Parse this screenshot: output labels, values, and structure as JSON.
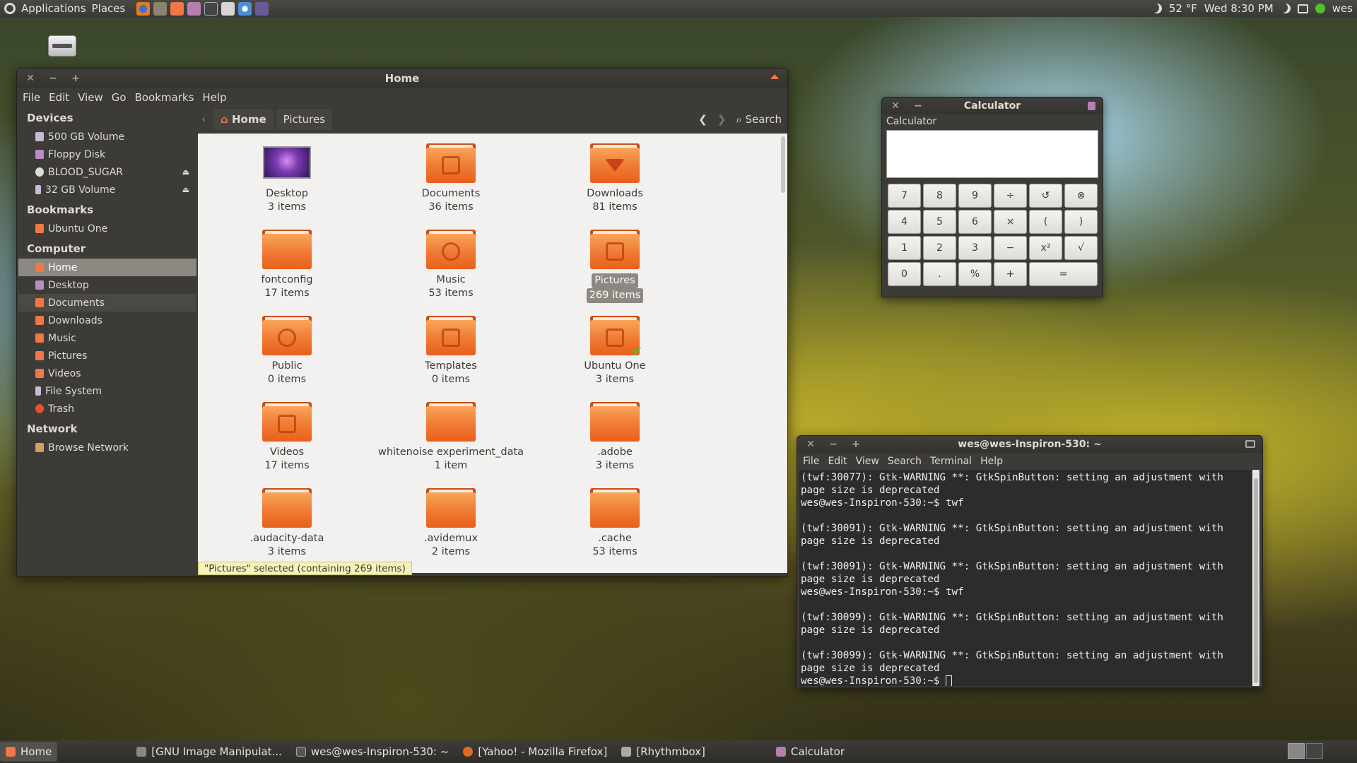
{
  "top_panel": {
    "applications": "Applications",
    "places": "Places",
    "weather": "52 °F",
    "clock": "Wed  8:30 PM",
    "user": "wes"
  },
  "nautilus": {
    "title": "Home",
    "menu": [
      "File",
      "Edit",
      "View",
      "Go",
      "Bookmarks",
      "Help"
    ],
    "sidebar": {
      "devices_header": "Devices",
      "devices": [
        "500 GB Volume",
        "Floppy Disk",
        "BLOOD_SUGAR",
        "32 GB Volume"
      ],
      "bookmarks_header": "Bookmarks",
      "bookmarks": [
        "Ubuntu One"
      ],
      "computer_header": "Computer",
      "computer": [
        "Home",
        "Desktop",
        "Documents",
        "Downloads",
        "Music",
        "Pictures",
        "Videos",
        "File System",
        "Trash"
      ],
      "network_header": "Network",
      "network": [
        "Browse Network"
      ]
    },
    "breadcrumbs": [
      "Home",
      "Pictures"
    ],
    "search_label": "Search",
    "files": [
      {
        "name": "Desktop",
        "count": "3 items"
      },
      {
        "name": "Documents",
        "count": "36 items"
      },
      {
        "name": "Downloads",
        "count": "81 items"
      },
      {
        "name": "fontconfig",
        "count": "17 items"
      },
      {
        "name": "Music",
        "count": "53 items"
      },
      {
        "name": "Pictures",
        "count": "269 items"
      },
      {
        "name": "Public",
        "count": "0 items"
      },
      {
        "name": "Templates",
        "count": "0 items"
      },
      {
        "name": "Ubuntu One",
        "count": "3 items"
      },
      {
        "name": "Videos",
        "count": "17 items"
      },
      {
        "name": "whitenoise experiment_data",
        "count": "1 item"
      },
      {
        "name": ".adobe",
        "count": "3 items"
      },
      {
        "name": ".audacity-data",
        "count": "3 items"
      },
      {
        "name": ".avidemux",
        "count": "2 items"
      },
      {
        "name": ".cache",
        "count": "53 items"
      }
    ],
    "status": "\"Pictures\" selected (containing 269 items)"
  },
  "calculator": {
    "title": "Calculator",
    "label": "Calculator",
    "keys": [
      "7",
      "8",
      "9",
      "÷",
      "↺",
      "⊗",
      "4",
      "5",
      "6",
      "×",
      "(",
      ")",
      "1",
      "2",
      "3",
      "−",
      "x²",
      "√",
      "0",
      ".",
      "%",
      "+",
      "="
    ]
  },
  "terminal": {
    "title": "wes@wes-Inspiron-530: ~",
    "menu": [
      "File",
      "Edit",
      "View",
      "Search",
      "Terminal",
      "Help"
    ],
    "lines": [
      "(twf:30077): Gtk-WARNING **: GtkSpinButton: setting an adjustment with",
      "page size is deprecated",
      "wes@wes-Inspiron-530:~$ twf",
      "",
      "(twf:30091): Gtk-WARNING **: GtkSpinButton: setting an adjustment with",
      "page size is deprecated",
      "",
      "(twf:30091): Gtk-WARNING **: GtkSpinButton: setting an adjustment with",
      "page size is deprecated",
      "wes@wes-Inspiron-530:~$ twf",
      "",
      "(twf:30099): Gtk-WARNING **: GtkSpinButton: setting an adjustment with",
      "page size is deprecated",
      "",
      "(twf:30099): Gtk-WARNING **: GtkSpinButton: setting an adjustment with",
      "page size is deprecated"
    ],
    "prompt": "wes@wes-Inspiron-530:~$ "
  },
  "taskbar": [
    {
      "label": "Home",
      "color": "#f07746"
    },
    {
      "label": "[GNU Image Manipulat...",
      "color": "#888888"
    },
    {
      "label": "wes@wes-Inspiron-530: ~",
      "color": "#555555"
    },
    {
      "label": "[Yahoo! - Mozilla Firefox]",
      "color": "#e06b1f"
    },
    {
      "label": "[Rhythmbox]",
      "color": "#aaaaaa"
    },
    {
      "label": "Calculator",
      "color": "#b77fb0"
    }
  ]
}
